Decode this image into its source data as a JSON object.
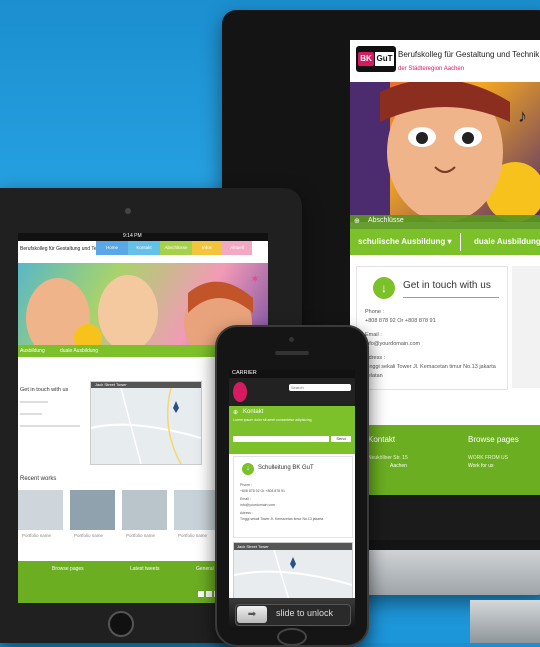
{
  "monitor": {
    "brand": {
      "bk": "BK",
      "gut": "GuT"
    },
    "title": "Berufskolleg für Gestaltung und Technik",
    "subtitle": "der Städteregion Aachen",
    "crumb": "Abschlüsse",
    "nav": [
      "schulische Ausbildung ▾",
      "duale Ausbildung"
    ],
    "contact": {
      "title": "Get in touch with us",
      "phone_label": "Phone :",
      "phone": "+808 878 92 Or +808 878 91",
      "email_label": "Email :",
      "email": "info@yourdomain.com",
      "address_label": "Adress :",
      "address1": "Tinggi sekali Tower Jl. Kemacetan timur No.13 jakarta",
      "address2": "selatan"
    },
    "footer": {
      "left_head": "Kontakt",
      "right_head": "Browse pages",
      "left_small": "Neuköllner Str. 15",
      "left_note": "Aachen",
      "right_small": "WORK FROM US",
      "right_note": "Work for us"
    }
  },
  "tablet": {
    "time": "9:14 PM",
    "title": "Berufskolleg für Gestaltung und Technik",
    "tabs": [
      "Home",
      "Kontakt",
      "Abschlüsse",
      "Infos",
      "Aktuell"
    ],
    "nav": [
      "Ausbildung",
      "duale Ausbildung"
    ],
    "contact_title": "Get in touch with us",
    "map_label": "Jack Street Tower",
    "recent": "Recent works",
    "thumb_label": "Portfolio name",
    "footer": [
      "Browse pages",
      "Latest tweets",
      "General"
    ]
  },
  "phone": {
    "carrier": "CARRIER",
    "search": "Search",
    "kontakt": "Kontakt",
    "green_text": "Lorem ipsum dolor sit amet consectetur adipisicing",
    "btn": "Send",
    "card_title": "Schulleitung BK GuT",
    "card_lines": [
      "Phone :",
      "+808 878 92 Or +808 878 91",
      "Email :",
      "info@yourdomain.com",
      "Adress :",
      "Tinggi sekali Tower Jl. Kemacetan timur No.13 jakarta"
    ],
    "map_label": "Jack Street Tower",
    "unlock": "slide to unlock"
  }
}
